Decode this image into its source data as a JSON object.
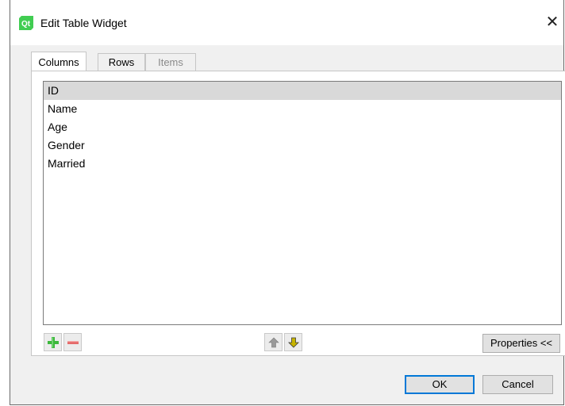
{
  "window": {
    "title": "Edit Table Widget",
    "close_glyph": "✕"
  },
  "tabs": [
    {
      "label": "Columns",
      "state": "active"
    },
    {
      "label": "Rows",
      "state": "normal"
    },
    {
      "label": "Items",
      "state": "disabled"
    }
  ],
  "columns_list": {
    "items": [
      "ID",
      "Name",
      "Age",
      "Gender",
      "Married"
    ],
    "selected_index": 0
  },
  "toolbar": {
    "add_icon": "plus-icon",
    "remove_icon": "minus-icon",
    "move_up_icon": "arrow-up-icon",
    "move_down_icon": "arrow-down-icon",
    "properties_label": "Properties <<"
  },
  "buttons": {
    "ok_label": "OK",
    "cancel_label": "Cancel"
  },
  "colors": {
    "accent": "#0078d7",
    "add_green": "#3cb83c",
    "remove_red": "#e46a6a",
    "arrow_gold": "#c7b400",
    "qt_green": "#41cd52"
  }
}
